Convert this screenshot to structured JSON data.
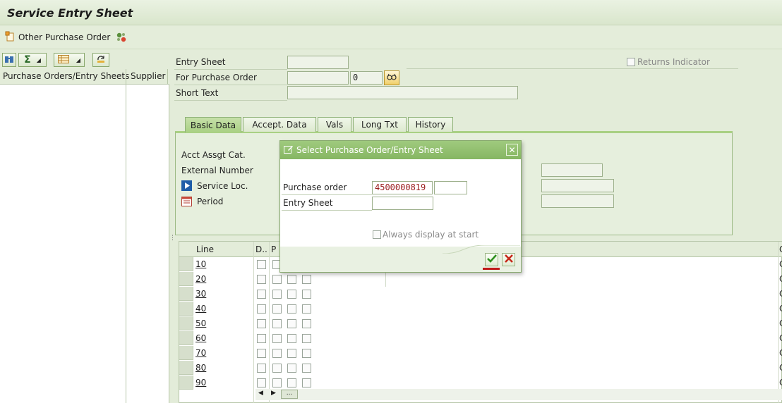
{
  "window": {
    "title": "Service Entry Sheet"
  },
  "app_toolbar": {
    "other_po_label": "Other Purchase Order",
    "services_icon": "services-icon"
  },
  "left_pane": {
    "columns": [
      "Purchase Orders/Entry Sheets",
      "Supplier"
    ]
  },
  "header_fields": {
    "entry_sheet_label": "Entry Sheet",
    "entry_sheet_value": "",
    "for_po_label": "For Purchase Order",
    "for_po_value": "",
    "for_po_item": "0",
    "short_text_label": "Short Text",
    "short_text_value": "",
    "returns_label": "Returns Indicator"
  },
  "tabs": [
    {
      "label": "Basic Data",
      "active": true
    },
    {
      "label": "Accept. Data",
      "active": false
    },
    {
      "label": "Vals",
      "active": false
    },
    {
      "label": "Long Txt",
      "active": false
    },
    {
      "label": "History",
      "active": false
    }
  ],
  "basic_data": {
    "acct_assgt_label": "Acct Assgt Cat.",
    "external_number_label": "External Number",
    "service_loc_label": "Service Loc.",
    "period_label": "Period"
  },
  "table": {
    "headers": {
      "line": "Line",
      "d": "D..",
      "p": "P"
    },
    "right_edge_glyph": "C",
    "rows": [
      "10",
      "20",
      "30",
      "40",
      "50",
      "60",
      "70",
      "80",
      "90"
    ]
  },
  "dialog": {
    "title": "Select Purchase Order/Entry Sheet",
    "po_label": "Purchase order",
    "po_value": "4500000819",
    "po_item_value": "",
    "entry_sheet_label": "Entry Sheet",
    "entry_sheet_value": "",
    "always_display_label": "Always display at start"
  },
  "colors": {
    "accent_green": "#86b662",
    "po_value_red": "#9a1c1c"
  }
}
